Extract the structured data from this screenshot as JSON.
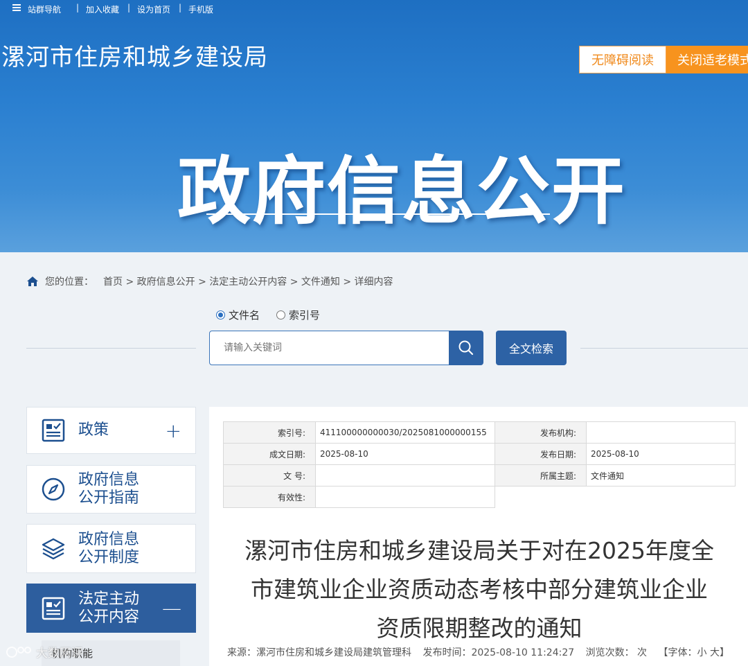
{
  "topbar": {
    "nav": "站群导航",
    "separator": "|",
    "favorite": "加入收藏",
    "homepage": "设为首页",
    "mobile": "手机版"
  },
  "header": {
    "site_title": "漯河市住房和城乡建设局",
    "accessibility": "无障碍阅读",
    "elder_mode": "关闭适老模式",
    "banner": "政府信息公开"
  },
  "breadcrumb": {
    "prefix": "您的位置：",
    "path": "首页 > 政府信息公开 > 法定主动公开内容 > 文件通知 > 详细内容"
  },
  "search": {
    "options": [
      "文件名",
      "索引号"
    ],
    "selected": "文件名",
    "placeholder": "请输入关键词",
    "fulltext_label": "全文检索"
  },
  "sidebar": {
    "items": [
      {
        "label": "政策",
        "toggle": "+",
        "icon": "policy-doc-icon"
      },
      {
        "label": "政府信息\n公开指南",
        "icon": "compass-icon"
      },
      {
        "label": "政府信息\n公开制度",
        "icon": "layers-icon"
      },
      {
        "label": "法定主动\n公开内容",
        "toggle": "—",
        "icon": "checklist-doc-icon",
        "active": true
      }
    ],
    "sub_item": "机构职能"
  },
  "watermark": "大数网评",
  "meta": {
    "index_no_label": "索引号:",
    "index_no": "411100000000030/2025081000000155",
    "publisher_label": "发布机构:",
    "publisher": "",
    "written_date_label": "成文日期:",
    "written_date": "2025-08-10",
    "publish_date_label": "发布日期:",
    "publish_date": "2025-08-10",
    "doc_no_label": "文 号:",
    "doc_no": "",
    "topic_label": "所属主题:",
    "topic": "文件通知",
    "validity_label": "有效性:",
    "validity": ""
  },
  "document": {
    "title_line1": "漯河市住房和城乡建设局关于对在2025年度全",
    "title_line2": "市建筑业企业资质动态考核中部分建筑业企业",
    "title_line3": "资质限期整改的通知",
    "source": "来源：漯河市住房和城乡建设局建筑管理科",
    "publish_time": "发布时间：2025-08-10 11:24:27",
    "views": "浏览次数：  次",
    "font_size": "【字体：小 大】"
  },
  "colors": {
    "header_blue": "#2a7fd0",
    "accent_orange": "#f7931e",
    "button_blue": "#2d62a5"
  }
}
